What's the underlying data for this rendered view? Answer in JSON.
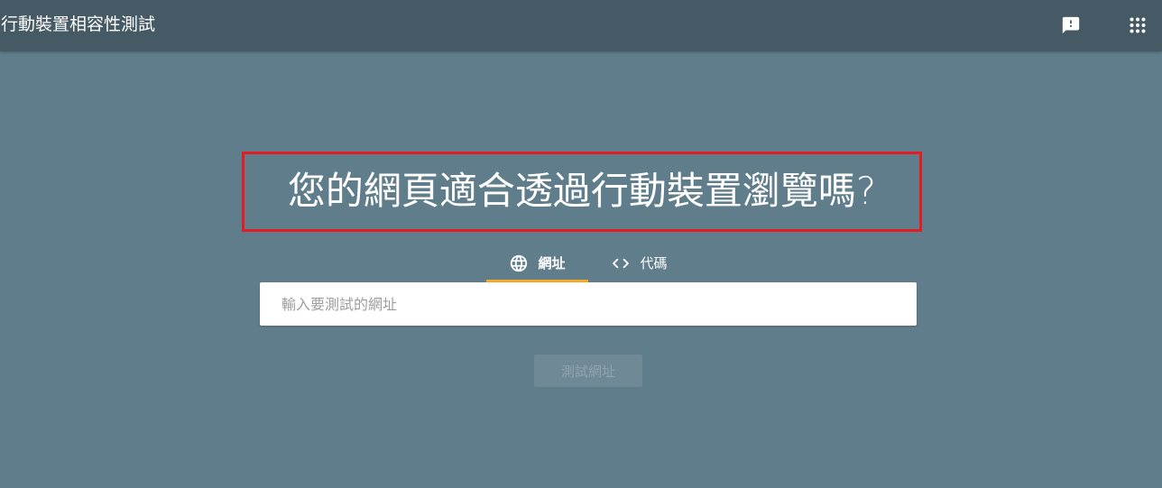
{
  "header": {
    "title": "行動裝置相容性測試",
    "feedback_icon": "feedback-icon",
    "apps_icon": "apps-grid-icon"
  },
  "main": {
    "headline": "您的網頁適合透過行動裝置瀏覽嗎?",
    "tabs": [
      {
        "label": "網址",
        "icon": "globe-icon",
        "selected": true
      },
      {
        "label": "代碼",
        "icon": "code-icon",
        "selected": false
      }
    ],
    "url_input": {
      "placeholder": "輸入要測試的網址",
      "value": ""
    },
    "test_button": {
      "label": "測試網址",
      "enabled": false
    }
  },
  "colors": {
    "background": "#607d8b",
    "topbar": "#455a64",
    "tab_indicator": "#f9a825",
    "highlight_border": "#e51c23"
  }
}
